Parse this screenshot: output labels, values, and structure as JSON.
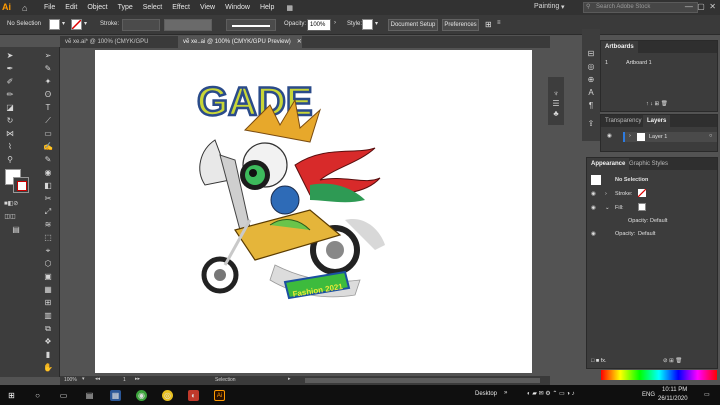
{
  "app": {
    "logo": "Ai",
    "workspace": "Painting",
    "search_placeholder": "Search Adobe Stock"
  },
  "menu": [
    "File",
    "Edit",
    "Object",
    "Type",
    "Select",
    "Effect",
    "View",
    "Window",
    "Help"
  ],
  "control_bar": {
    "selection": "No Selection",
    "stroke_label": "Stroke:",
    "opacity_label": "Opacity:",
    "opacity_value": "100%",
    "style_label": "Style:",
    "document_setup": "Document Setup",
    "preferences": "Preferences"
  },
  "doc_tabs": [
    {
      "label": "vẽ xe.ai* @ 100% (CMYK/GPU Preview)",
      "active": false
    },
    {
      "label": "vẽ xe..ai @ 100% (CMYK/GPU Preview)",
      "active": true
    }
  ],
  "artwork": {
    "title": "GADE",
    "badge": "Fashion 2021"
  },
  "status_bar": {
    "zoom": "100%",
    "artboard_num": "1",
    "mode": "Selection"
  },
  "artboards_panel": {
    "tab": "Artboards",
    "row_num": "1",
    "row_name": "Artboard 1"
  },
  "layers_panel": {
    "tabs": [
      "Transparency",
      "Layers"
    ],
    "layer_name": "Layer 1"
  },
  "appearance_panel": {
    "tabs": [
      "Appearance",
      "Graphic Styles"
    ],
    "selection": "No Selection",
    "stroke": "Stroke:",
    "fill": "Fill:",
    "opacity1": "Opacity:",
    "opacity1_value": "Default",
    "opacity2": "Opacity:",
    "opacity2_value": "Default"
  },
  "taskbar": {
    "desktop": "Desktop",
    "lang": "ENG",
    "time": "10:11 PM",
    "date": "26/11/2020"
  },
  "colors": {
    "accent_orange": "#ff9a00",
    "panel_bg": "#3c3c3c",
    "app_bg": "#535353"
  }
}
